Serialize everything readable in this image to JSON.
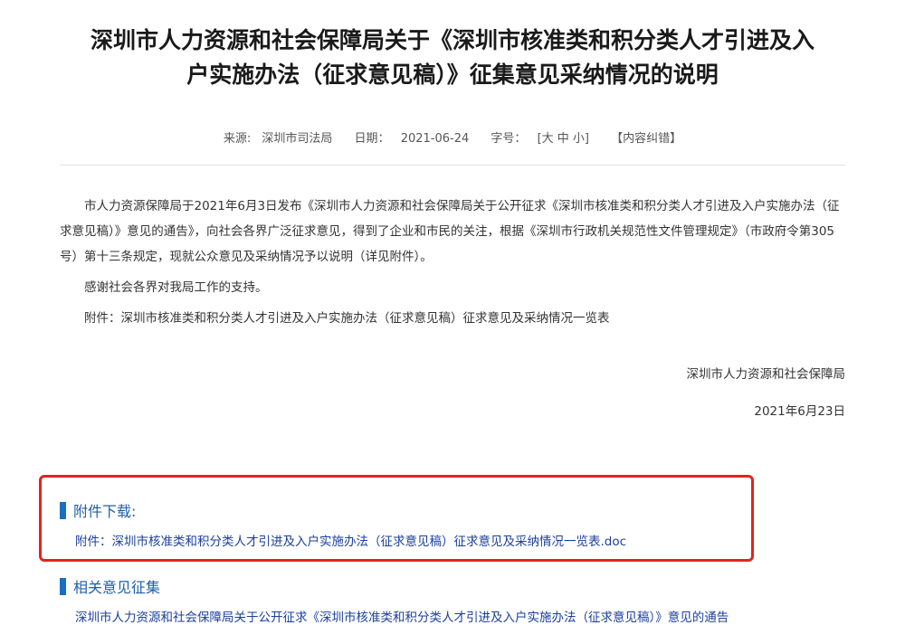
{
  "article": {
    "title_line1": "深圳市人力资源和社会保障局关于《深圳市核准类和积分类人才引进及入",
    "title_line2": "户实施办法（征求意见稿）》征集意见采纳情况的说明"
  },
  "meta": {
    "source_label": "来源:",
    "source_value": "深圳市司法局",
    "date_label": "日期：",
    "date_value": "2021-06-24",
    "font_size_label": "字号：",
    "font_size_options": "[大 中 小]",
    "correction_link": "【内容纠错】"
  },
  "body": {
    "paragraph1": "市人力资源保障局于2021年6月3日发布《深圳市人力资源和社会保障局关于公开征求《深圳市核准类和积分类人才引进及入户实施办法（征求意见稿）》意见的通告》，向社会各界广泛征求意见，得到了企业和市民的关注，根据《深圳市行政机关规范性文件管理规定》（市政府令第305号）第十三条规定，现就公众意见及采纳情况予以说明（详见附件）。",
    "paragraph2": "感谢社会各界对我局工作的支持。",
    "attachment_note": "附件：深圳市核准类和积分类人才引进及入户实施办法（征求意见稿）征求意见及采纳情况一览表",
    "signature_org": "深圳市人力资源和社会保障局",
    "signature_date": "2021年6月23日"
  },
  "downloads": {
    "heading": "附件下载:",
    "file_link": "附件：深圳市核准类和积分类人才引进及入户实施办法（征求意见稿）征求意见及采纳情况一览表.doc"
  },
  "related": {
    "heading": "相关意见征集",
    "item_link": "深圳市人力资源和社会保障局关于公开征求《深圳市核准类和积分类人才引进及入户实施办法（征求意见稿）》意见的通告"
  },
  "colors": {
    "accent_blue": "#1a6fc2",
    "link_blue": "#1c3f9e",
    "highlight_red": "#e2241f"
  }
}
